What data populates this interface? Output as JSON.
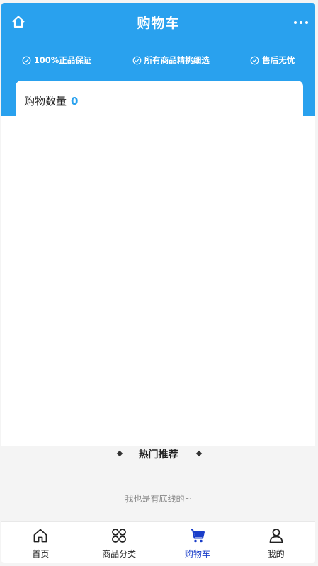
{
  "header": {
    "title": "购物车",
    "home_icon": "home-icon",
    "more_icon": "more-icon"
  },
  "guarantees": [
    {
      "label": "100%正品保证",
      "icon": "check-circle-icon"
    },
    {
      "label": "所有商品精挑细选",
      "icon": "check-circle-icon"
    },
    {
      "label": "售后无忧",
      "icon": "check-circle-icon"
    }
  ],
  "cart": {
    "count_label": "购物数量",
    "count_value": "0"
  },
  "recommend": {
    "title": "热门推荐",
    "bottom_text": "我也是有底线的~"
  },
  "tabbar": {
    "tabs": [
      {
        "label": "首页",
        "icon": "home-icon"
      },
      {
        "label": "商品分类",
        "icon": "category-icon"
      },
      {
        "label": "购物车",
        "icon": "cart-icon",
        "active": true
      },
      {
        "label": "我的",
        "icon": "user-icon"
      }
    ]
  },
  "colors": {
    "header_bg": "#29a1ee",
    "active_tab": "#1a3ec9",
    "count_accent": "#29a1ee"
  }
}
